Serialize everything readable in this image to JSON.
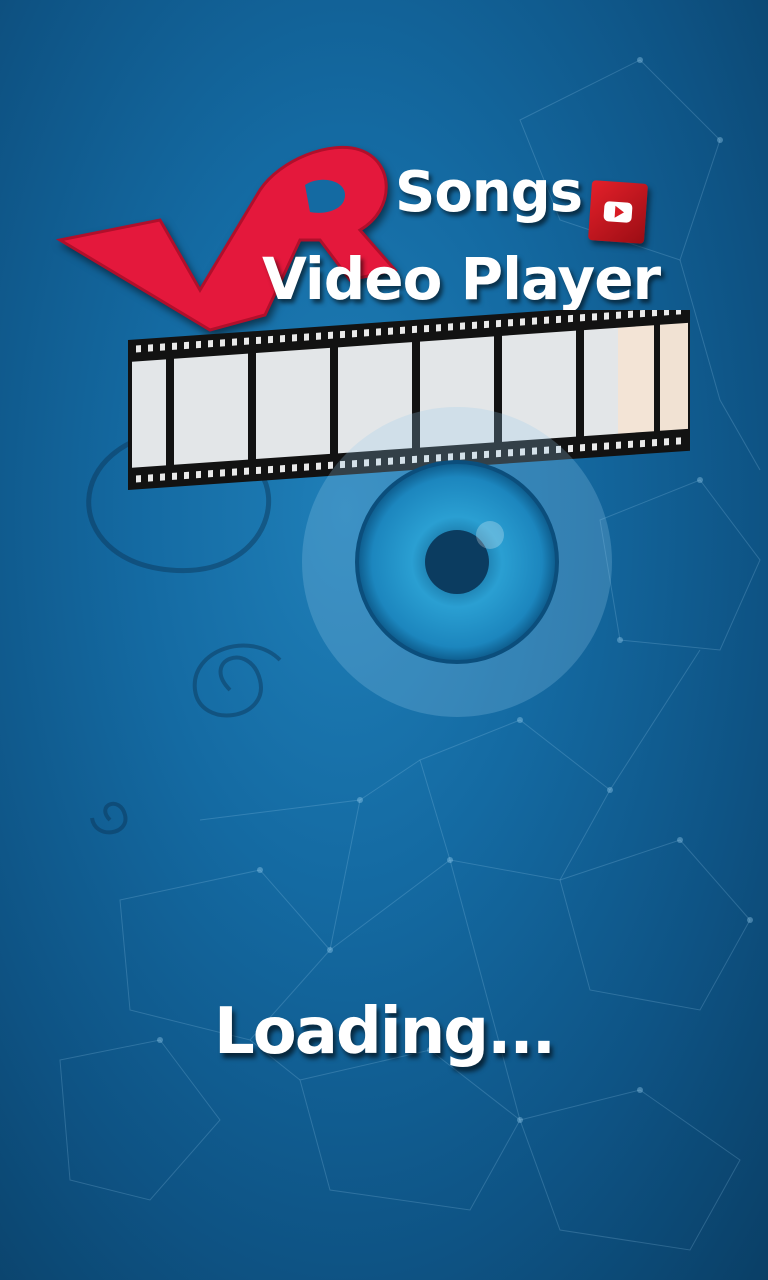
{
  "splash": {
    "logo": {
      "mark_text": "VR",
      "title_line1": "Songs",
      "title_line2": "Video Player",
      "badge_icon": "play-icon"
    },
    "status_text": "Loading...",
    "colors": {
      "background": "#146aa2",
      "logo_red": "#e4183c",
      "text": "#ffffff"
    }
  }
}
